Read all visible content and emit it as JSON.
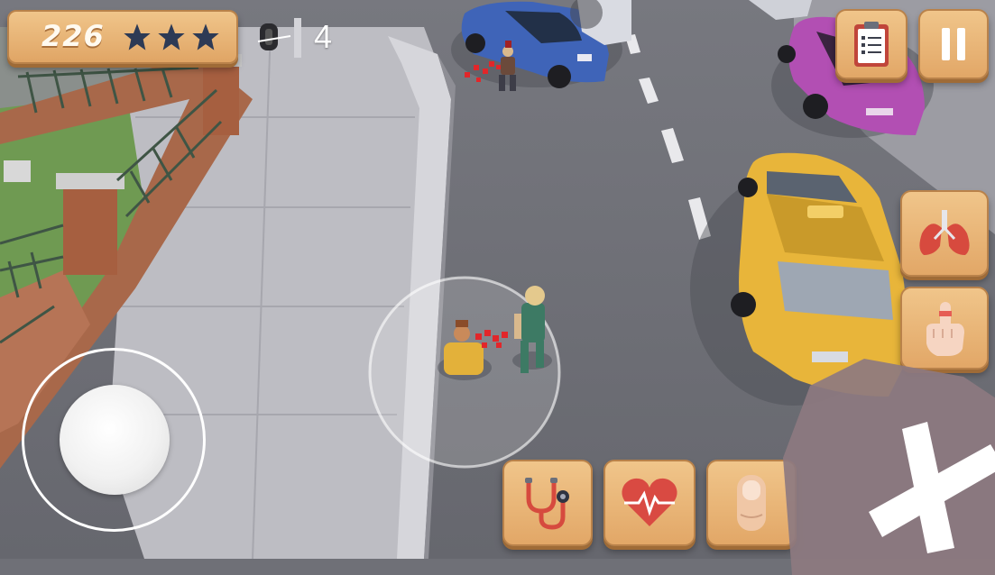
{
  "hud": {
    "score": "226",
    "stars_earned": 3,
    "stars_total": 3,
    "star_color": "#2d3a55",
    "counter_value": "4"
  },
  "icons": {
    "tire": "tire-icon",
    "clipboard": "clipboard-icon",
    "pause": "pause-icon",
    "lungs": "lungs-icon",
    "finger_bandage": "bandaged-finger-icon",
    "stethoscope": "stethoscope-icon",
    "heart_pulse": "heart-pulse-icon",
    "finger": "finger-icon",
    "cancel": "cancel-x-icon"
  },
  "colors": {
    "button_face": "#e8b377",
    "button_border": "#b9824a",
    "road": "#6f7077",
    "sidewalk": "#b8b8be",
    "grass": "#6f9a52",
    "taxi": "#e8b53a",
    "blue_car": "#3f64b8",
    "purple_car": "#b24fb3",
    "cancel_zone": "#8d7a80"
  }
}
